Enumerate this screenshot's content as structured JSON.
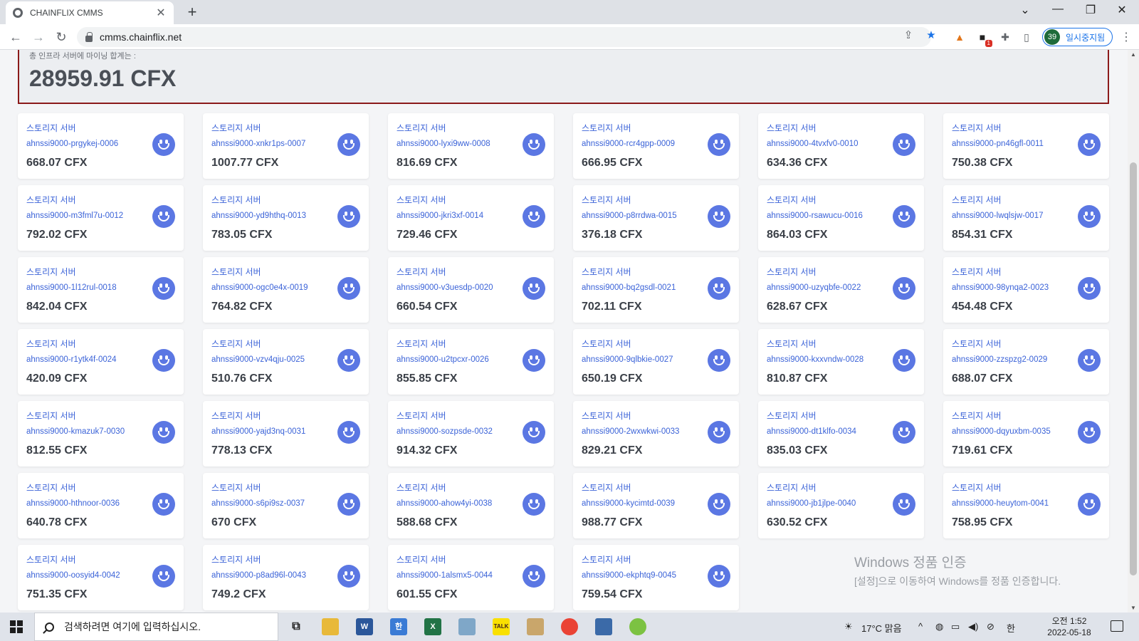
{
  "browser": {
    "tab_title": "CHAINFLIX CMMS",
    "tab_close": "✕",
    "new_tab": "+",
    "url": "cmms.chainflix.net",
    "profile_number": "39",
    "profile_label": "일시중지됨",
    "extension_badge": "1"
  },
  "summary": {
    "label": "총 인프라 서버에 마이닝 합계는 :",
    "total": "28959.91 CFX"
  },
  "cards": [
    {
      "type": "스토리지 서버",
      "server": "ahnssi9000-prgykej-0006",
      "amount": "668.07 CFX"
    },
    {
      "type": "스토리지 서버",
      "server": "ahnssi9000-xnkr1ps-0007",
      "amount": "1007.77 CFX"
    },
    {
      "type": "스토리지 서버",
      "server": "ahnssi9000-lyxi9ww-0008",
      "amount": "816.69 CFX"
    },
    {
      "type": "스토리지 서버",
      "server": "ahnssi9000-rcr4gpp-0009",
      "amount": "666.95 CFX"
    },
    {
      "type": "스토리지 서버",
      "server": "ahnssi9000-4tvxfv0-0010",
      "amount": "634.36 CFX"
    },
    {
      "type": "스토리지 서버",
      "server": "ahnssi9000-pn46gfl-0011",
      "amount": "750.38 CFX"
    },
    {
      "type": "스토리지 서버",
      "server": "ahnssi9000-m3fml7u-0012",
      "amount": "792.02 CFX"
    },
    {
      "type": "스토리지 서버",
      "server": "ahnssi9000-yd9hthq-0013",
      "amount": "783.05 CFX"
    },
    {
      "type": "스토리지 서버",
      "server": "ahnssi9000-jkri3xf-0014",
      "amount": "729.46 CFX"
    },
    {
      "type": "스토리지 서버",
      "server": "ahnssi9000-p8rrdwa-0015",
      "amount": "376.18 CFX"
    },
    {
      "type": "스토리지 서버",
      "server": "ahnssi9000-rsawucu-0016",
      "amount": "864.03 CFX"
    },
    {
      "type": "스토리지 서버",
      "server": "ahnssi9000-lwqlsjw-0017",
      "amount": "854.31 CFX"
    },
    {
      "type": "스토리지 서버",
      "server": "ahnssi9000-1l12rul-0018",
      "amount": "842.04 CFX"
    },
    {
      "type": "스토리지 서버",
      "server": "ahnssi9000-ogc0e4x-0019",
      "amount": "764.82 CFX"
    },
    {
      "type": "스토리지 서버",
      "server": "ahnssi9000-v3uesdp-0020",
      "amount": "660.54 CFX"
    },
    {
      "type": "스토리지 서버",
      "server": "ahnssi9000-bq2gsdl-0021",
      "amount": "702.11 CFX"
    },
    {
      "type": "스토리지 서버",
      "server": "ahnssi9000-uzyqbfe-0022",
      "amount": "628.67 CFX"
    },
    {
      "type": "스토리지 서버",
      "server": "ahnssi9000-98ynqa2-0023",
      "amount": "454.48 CFX"
    },
    {
      "type": "스토리지 서버",
      "server": "ahnssi9000-r1ytk4f-0024",
      "amount": "420.09 CFX"
    },
    {
      "type": "스토리지 서버",
      "server": "ahnssi9000-vzv4qju-0025",
      "amount": "510.76 CFX"
    },
    {
      "type": "스토리지 서버",
      "server": "ahnssi9000-u2tpcxr-0026",
      "amount": "855.85 CFX"
    },
    {
      "type": "스토리지 서버",
      "server": "ahnssi9000-9qlbkie-0027",
      "amount": "650.19 CFX"
    },
    {
      "type": "스토리지 서버",
      "server": "ahnssi9000-kxxvndw-0028",
      "amount": "810.87 CFX"
    },
    {
      "type": "스토리지 서버",
      "server": "ahnssi9000-zzspzg2-0029",
      "amount": "688.07 CFX"
    },
    {
      "type": "스토리지 서버",
      "server": "ahnssi9000-kmazuk7-0030",
      "amount": "812.55 CFX"
    },
    {
      "type": "스토리지 서버",
      "server": "ahnssi9000-yajd3nq-0031",
      "amount": "778.13 CFX"
    },
    {
      "type": "스토리지 서버",
      "server": "ahnssi9000-sozpsde-0032",
      "amount": "914.32 CFX"
    },
    {
      "type": "스토리지 서버",
      "server": "ahnssi9000-2wxwkwi-0033",
      "amount": "829.21 CFX"
    },
    {
      "type": "스토리지 서버",
      "server": "ahnssi9000-dt1klfo-0034",
      "amount": "835.03 CFX"
    },
    {
      "type": "스토리지 서버",
      "server": "ahnssi9000-dqyuxbm-0035",
      "amount": "719.61 CFX"
    },
    {
      "type": "스토리지 서버",
      "server": "ahnssi9000-hthnoor-0036",
      "amount": "640.78 CFX"
    },
    {
      "type": "스토리지 서버",
      "server": "ahnssi9000-s6pi9sz-0037",
      "amount": "670 CFX"
    },
    {
      "type": "스토리지 서버",
      "server": "ahnssi9000-ahow4yi-0038",
      "amount": "588.68 CFX"
    },
    {
      "type": "스토리지 서버",
      "server": "ahnssi9000-kycimtd-0039",
      "amount": "988.77 CFX"
    },
    {
      "type": "스토리지 서버",
      "server": "ahnssi9000-jb1jlpe-0040",
      "amount": "630.52 CFX"
    },
    {
      "type": "스토리지 서버",
      "server": "ahnssi9000-heuytom-0041",
      "amount": "758.95 CFX"
    },
    {
      "type": "스토리지 서버",
      "server": "ahnssi9000-oosyid4-0042",
      "amount": "751.35 CFX"
    },
    {
      "type": "스토리지 서버",
      "server": "ahnssi9000-p8ad96l-0043",
      "amount": "749.2 CFX"
    },
    {
      "type": "스토리지 서버",
      "server": "ahnssi9000-1alsmx5-0044",
      "amount": "601.55 CFX"
    },
    {
      "type": "스토리지 서버",
      "server": "ahnssi9000-ekphtq9-0045",
      "amount": "759.54 CFX"
    }
  ],
  "watermark": {
    "line1": "Windows 정품 인증",
    "line2": "[설정]으로 이동하여 Windows를 정품 인증합니다."
  },
  "taskbar": {
    "search_placeholder": "검색하려면 여기에 입력하십시오.",
    "weather": "17°C  맑음",
    "ime": "한",
    "time": "오전 1:52",
    "date": "2022-05-18"
  },
  "colors": {
    "accent_blue": "#3b63d8",
    "icon_blue": "#5b77e3",
    "summary_border": "#8b1a1a"
  }
}
